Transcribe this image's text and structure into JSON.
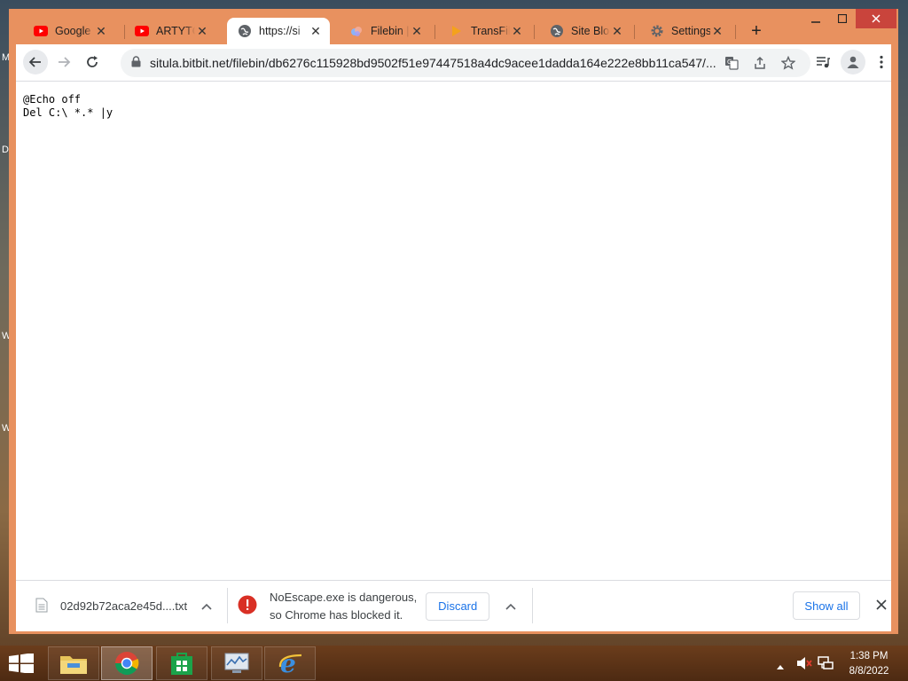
{
  "desktop": {
    "edge_letters": [
      "M",
      "D",
      "W",
      "W"
    ]
  },
  "tabs": [
    {
      "label": "Google C",
      "icon": "youtube-icon",
      "active": false
    },
    {
      "label": "ARTYTCP",
      "icon": "youtube-icon",
      "active": false
    },
    {
      "label": "https://si",
      "icon": "globe-icon",
      "active": true
    },
    {
      "label": "Filebin | c",
      "icon": "filebin-icon",
      "active": false
    },
    {
      "label": "TransFile",
      "icon": "transfile-icon",
      "active": false
    },
    {
      "label": "Site Block",
      "icon": "globe-icon",
      "active": false
    },
    {
      "label": "Settings",
      "icon": "gear-icon",
      "active": false
    }
  ],
  "toolbar": {
    "url": "situla.bitbit.net/filebin/db6276c115928bd9502f51e97447518a4dc9acee1dadda164e222e8bb11ca547/..."
  },
  "content": {
    "lines": [
      "@Echo off",
      "Del C:\\ *.* |y"
    ]
  },
  "downloads": {
    "file_name": "02d92b72aca2e45d....txt",
    "warning_line1": "NoEscape.exe is dangerous,",
    "warning_line2": "so Chrome has blocked it.",
    "discard_label": "Discard",
    "show_all_label": "Show all"
  },
  "taskbar": {
    "time": "1:38 PM",
    "date": "8/8/2022"
  },
  "colors": {
    "window_frame": "#e8915f",
    "close_button": "#c9443c",
    "link_blue": "#1a73e8",
    "danger_red": "#d93025",
    "youtube_red": "#ff0000"
  }
}
